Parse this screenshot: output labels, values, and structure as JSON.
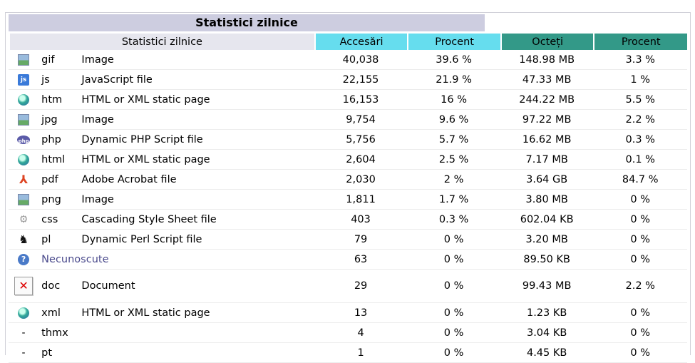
{
  "title": "Statistici zilnice",
  "headers": {
    "label": "Statistici zilnice",
    "hits": "Accesări",
    "hits_pct": "Procent",
    "bytes": "Octeți",
    "bytes_pct": "Procent"
  },
  "rows": [
    {
      "icon": "image-icon",
      "ext": "gif",
      "desc": "Image",
      "hits": "40,038",
      "hits_pct": "39.6 %",
      "bytes": "148.98 MB",
      "bytes_pct": "3.3 %"
    },
    {
      "icon": "javascript-file-icon",
      "ext": "js",
      "desc": "JavaScript file",
      "hits": "22,155",
      "hits_pct": "21.9 %",
      "bytes": "47.33 MB",
      "bytes_pct": "1 %"
    },
    {
      "icon": "globe-icon",
      "ext": "htm",
      "desc": "HTML or XML static page",
      "hits": "16,153",
      "hits_pct": "16 %",
      "bytes": "244.22 MB",
      "bytes_pct": "5.5 %"
    },
    {
      "icon": "image-icon",
      "ext": "jpg",
      "desc": "Image",
      "hits": "9,754",
      "hits_pct": "9.6 %",
      "bytes": "97.22 MB",
      "bytes_pct": "2.2 %"
    },
    {
      "icon": "php-icon",
      "ext": "php",
      "desc": "Dynamic PHP Script file",
      "hits": "5,756",
      "hits_pct": "5.7 %",
      "bytes": "16.62 MB",
      "bytes_pct": "0.3 %"
    },
    {
      "icon": "globe-icon",
      "ext": "html",
      "desc": "HTML or XML static page",
      "hits": "2,604",
      "hits_pct": "2.5 %",
      "bytes": "7.17 MB",
      "bytes_pct": "0.1 %"
    },
    {
      "icon": "pdf-icon",
      "ext": "pdf",
      "desc": "Adobe Acrobat file",
      "hits": "2,030",
      "hits_pct": "2 %",
      "bytes": "3.64 GB",
      "bytes_pct": "84.7 %"
    },
    {
      "icon": "image-icon",
      "ext": "png",
      "desc": "Image",
      "hits": "1,811",
      "hits_pct": "1.7 %",
      "bytes": "3.80 MB",
      "bytes_pct": "0 %"
    },
    {
      "icon": "css-file-icon",
      "ext": "css",
      "desc": "Cascading Style Sheet file",
      "hits": "403",
      "hits_pct": "0.3 %",
      "bytes": "602.04 KB",
      "bytes_pct": "0 %"
    },
    {
      "icon": "perl-camel-icon",
      "ext": "pl",
      "desc": "Dynamic Perl Script file",
      "hits": "79",
      "hits_pct": "0 %",
      "bytes": "3.20 MB",
      "bytes_pct": "0 %"
    },
    {
      "icon": "help-icon",
      "ext": "",
      "desc": "Necunoscute",
      "hits": "63",
      "hits_pct": "0 %",
      "bytes": "89.50 KB",
      "bytes_pct": "0 %"
    },
    {
      "icon": "broken-image-icon",
      "ext": "doc",
      "desc": "Document",
      "hits": "29",
      "hits_pct": "0 %",
      "bytes": "99.43 MB",
      "bytes_pct": "2.2 %"
    },
    {
      "icon": "globe-icon",
      "ext": "xml",
      "desc": "HTML or XML static page",
      "hits": "13",
      "hits_pct": "0 %",
      "bytes": "1.23 KB",
      "bytes_pct": "0 %"
    },
    {
      "icon": "dash",
      "ext": "thmx",
      "desc": "",
      "hits": "4",
      "hits_pct": "0 %",
      "bytes": "3.04 KB",
      "bytes_pct": "0 %"
    },
    {
      "icon": "dash",
      "ext": "pt",
      "desc": "",
      "hits": "1",
      "hits_pct": "0 %",
      "bytes": "4.45 KB",
      "bytes_pct": "0 %"
    }
  ]
}
